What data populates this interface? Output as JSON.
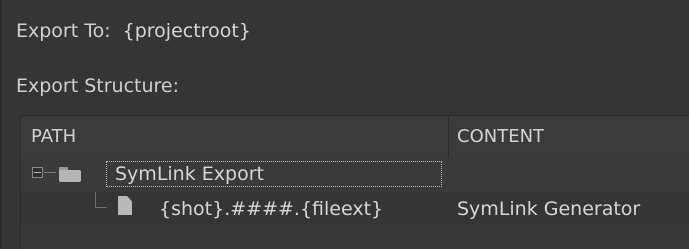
{
  "export_to": {
    "label": "Export To:",
    "value": "{projectroot}"
  },
  "structure": {
    "label": "Export Structure:"
  },
  "tree": {
    "columns": {
      "path": "PATH",
      "content": "CONTENT"
    },
    "rows": [
      {
        "path": "SymLink Export",
        "content": "",
        "icon": "folder-icon",
        "expanded": true,
        "selected": true
      },
      {
        "path": "{shot}.####.{fileext}",
        "content": "SymLink Generator",
        "icon": "file-icon"
      }
    ]
  },
  "colors": {
    "background": "#353535",
    "text": "#cfcfcf",
    "tree_background": "#393939"
  }
}
